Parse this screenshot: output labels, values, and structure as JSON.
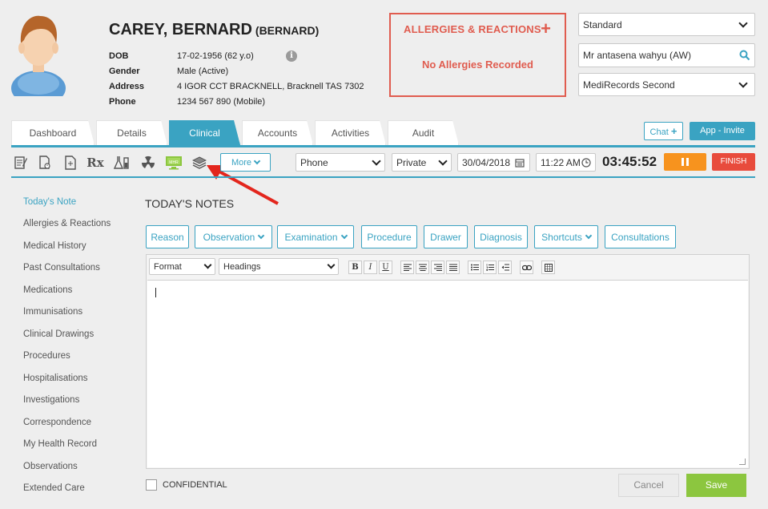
{
  "patient": {
    "surname_first": "CAREY, BERNARD",
    "preferred": "(BERNARD)",
    "fields": [
      {
        "label": "DOB",
        "value": "17-02-1956 (62 y.o)"
      },
      {
        "label": "Gender",
        "value": "Male (Active)"
      },
      {
        "label": "Address",
        "value": "4 IGOR CCT BRACKNELL, Bracknell TAS 7302"
      },
      {
        "label": "Phone",
        "value": "1234 567 890 (Mobile)"
      }
    ],
    "info_glyph": "i"
  },
  "allergies": {
    "title": "ALLERGIES & REACTIONS",
    "add_glyph": "+",
    "status": "No Allergies Recorded",
    "color": "#e05c4f"
  },
  "right_panel": {
    "appointment_type": "Standard",
    "practitioner": "Mr antasena wahyu (AW)",
    "location": "MediRecords Second"
  },
  "tabs": [
    "Dashboard",
    "Details",
    "Clinical",
    "Accounts",
    "Activities",
    "Audit"
  ],
  "active_tab": "Clinical",
  "header_buttons": {
    "chat": "Chat",
    "chat_glyph": "+",
    "app_invite": "App - Invite"
  },
  "toolbar": {
    "icons": [
      "notes-icon",
      "reminder-icon",
      "document-icon",
      "prescription-icon",
      "lab-icon",
      "radiation-icon",
      "mhr-monitor-icon",
      "stack-icon"
    ],
    "mhr_text": "MHR",
    "rx_text": "Rx",
    "more": "More",
    "contact_mode": "Phone",
    "billing": "Private",
    "date": "30/04/2018",
    "time": "11:22 AM",
    "timer": "03:45:52",
    "finish": "FINISH",
    "accent": "#3aa3c2",
    "pause_color": "#f7931e",
    "finish_color": "#e84b3c"
  },
  "side_nav": [
    "Today's Note",
    "Allergies & Reactions",
    "Medical History",
    "Past Consultations",
    "Medications",
    "Immunisations",
    "Clinical Drawings",
    "Procedures",
    "Hospitalisations",
    "Investigations",
    "Correspondence",
    "My Health Record",
    "Observations",
    "Extended Care"
  ],
  "notes": {
    "title": "TODAY'S NOTES",
    "buttons": [
      "Reason",
      "Observation",
      "Examination",
      "Procedure",
      "Drawer",
      "Diagnosis",
      "Shortcuts",
      "Consultations"
    ],
    "format_select": "Format",
    "headings_select": "Headings",
    "editor_glyphs": {
      "bold": "B",
      "italic": "I",
      "underline": "U"
    },
    "confidential": "CONFIDENTIAL",
    "cancel": "Cancel",
    "save": "Save",
    "save_color": "#8cc63f"
  }
}
